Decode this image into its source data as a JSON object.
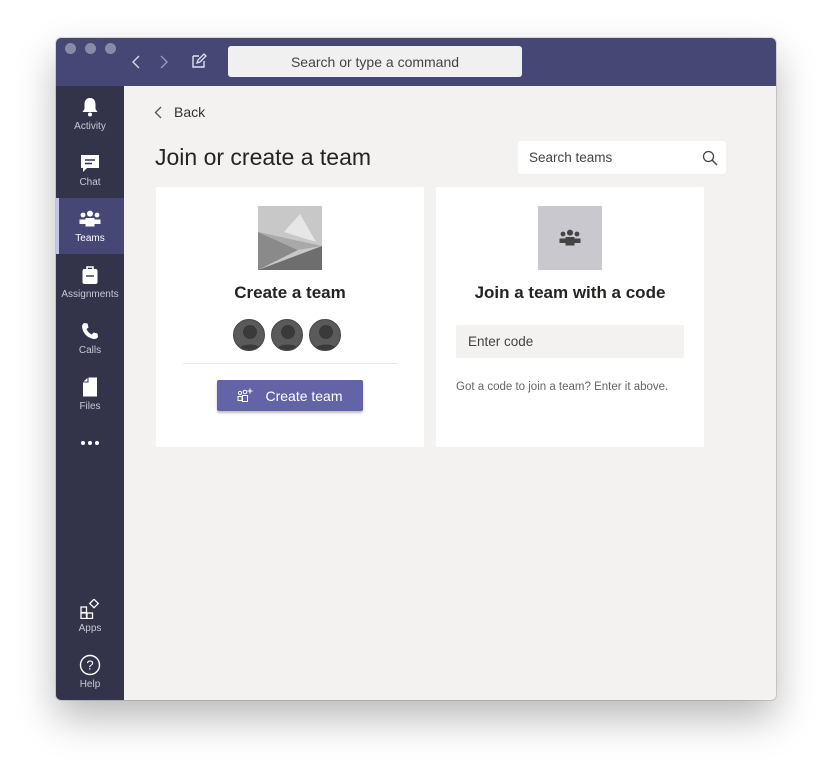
{
  "titlebar": {
    "search_placeholder": "Search or type a command"
  },
  "rail": {
    "items": [
      {
        "label": "Activity",
        "icon": "bell-icon"
      },
      {
        "label": "Chat",
        "icon": "chat-icon"
      },
      {
        "label": "Teams",
        "icon": "teams-icon",
        "active": true
      },
      {
        "label": "Assignments",
        "icon": "assignments-icon"
      },
      {
        "label": "Calls",
        "icon": "phone-icon"
      },
      {
        "label": "Files",
        "icon": "file-icon"
      },
      {
        "label": "",
        "icon": "more-icon"
      },
      {
        "label": "Apps",
        "icon": "apps-icon"
      },
      {
        "label": "Help",
        "icon": "help-icon"
      }
    ]
  },
  "main": {
    "back_label": "Back",
    "title": "Join or create a team",
    "search_placeholder": "Search teams",
    "create_card": {
      "title": "Create a team",
      "button_label": "Create team"
    },
    "join_card": {
      "title": "Join a team with a code",
      "input_placeholder": "Enter code",
      "hint": "Got a code to join a team? Enter it above."
    }
  },
  "colors": {
    "titlebar": "#464775",
    "rail": "#33344a",
    "accent": "#6264a7",
    "background": "#f3f2f1"
  }
}
